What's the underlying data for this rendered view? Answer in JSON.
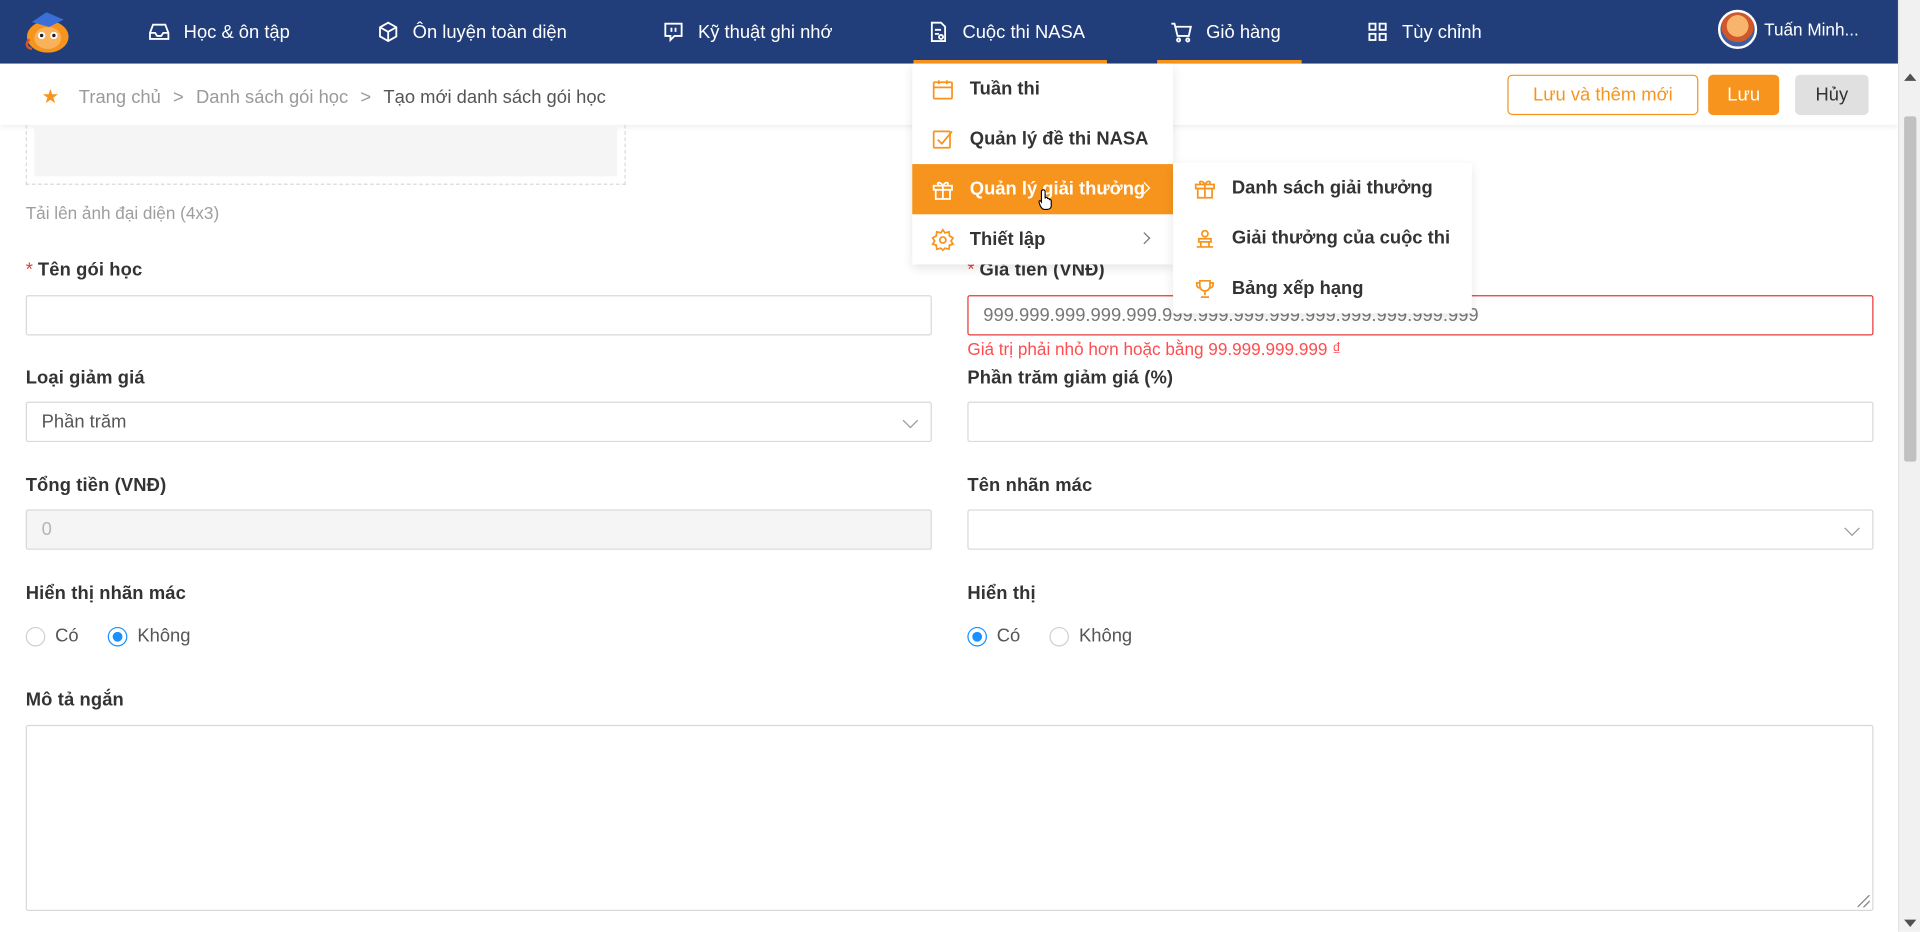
{
  "nav": {
    "items": [
      {
        "label": "Học & ôn tập",
        "icon": "inbox-icon"
      },
      {
        "label": "Ôn luyện toàn diện",
        "icon": "cube-icon"
      },
      {
        "label": "Kỹ thuật ghi nhớ",
        "icon": "chat-icon"
      },
      {
        "label": "Cuộc thi NASA",
        "icon": "exam-icon"
      },
      {
        "label": "Giỏ hàng",
        "icon": "cart-icon"
      },
      {
        "label": "Tùy chỉnh",
        "icon": "grid-icon"
      }
    ],
    "user_name": "Tuấn Minh...",
    "accent_color": "#f7941d",
    "bg_color": "#223e7a"
  },
  "breadcrumb": {
    "home": "Trang chủ",
    "sep": ">",
    "list": "Danh sách gói học",
    "current": "Tạo mới danh sách gói học"
  },
  "actions": {
    "save_and_new": "Lưu và thêm mới",
    "save": "Lưu",
    "cancel": "Hủy"
  },
  "form": {
    "upload_hint": "Tải lên ảnh đại diện (4x3)",
    "name_label": "Tên gói học",
    "price_label": "Giá tiền (VNĐ)",
    "price_value": "999.999.999.999.999.999.999.999.999.999.999.999.999.999",
    "price_error": "Giá trị phải nhỏ hơn hoặc bằng 99.999.999.999 ₫",
    "discount_type_label": "Loại giảm giá",
    "discount_type_value": "Phần trăm",
    "discount_percent_label": "Phần trăm giảm giá (%)",
    "total_label": "Tổng tiền (VNĐ)",
    "total_value": "0",
    "brand_label": "Tên nhãn mác",
    "show_brand_label": "Hiển thị nhãn mác",
    "show_label": "Hiển thị",
    "yes": "Có",
    "no": "Không",
    "short_desc_label": "Mô tả ngắn",
    "required_mark": "*"
  },
  "dropdown": {
    "items": [
      {
        "label": "Tuần thi",
        "icon": "calendar-icon"
      },
      {
        "label": "Quản lý đề thi NASA",
        "icon": "checkbox-icon"
      },
      {
        "label": "Quản lý giải thưởng",
        "icon": "gift-icon"
      },
      {
        "label": "Thiết lập",
        "icon": "settings-icon"
      }
    ],
    "submenu": [
      {
        "label": "Danh sách giải thưởng",
        "icon": "gift-icon"
      },
      {
        "label": "Giải thưởng của cuộc thi",
        "icon": "award-icon"
      },
      {
        "label": "Bảng xếp hạng",
        "icon": "trophy-icon"
      }
    ]
  }
}
